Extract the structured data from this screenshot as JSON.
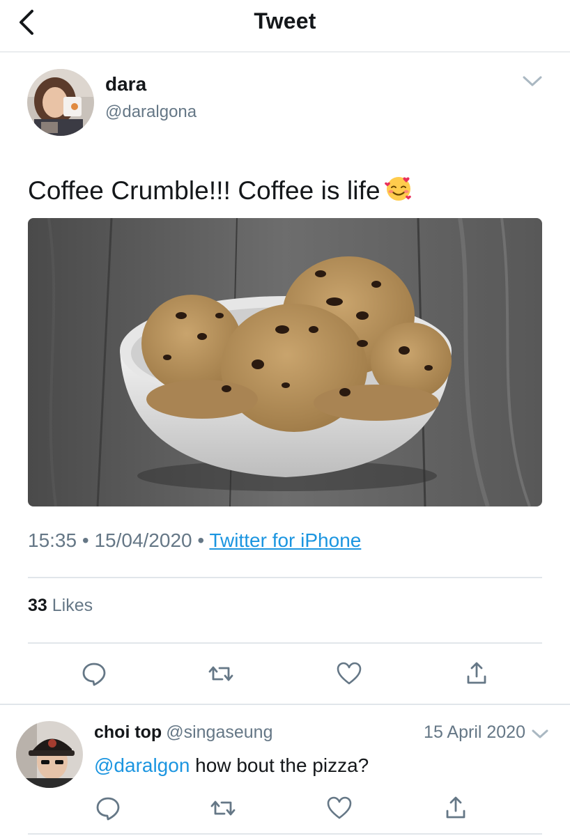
{
  "header": {
    "title": "Tweet",
    "back_icon": "chevron-left-icon"
  },
  "tweet": {
    "author_name": "dara",
    "author_handle": "@daralgona",
    "text": "Coffee Crumble!!! Coffee is life",
    "emoji": "smiling-face-with-hearts-icon",
    "media": "bowl of coffee crumble ice cream",
    "time": "15:35",
    "date": "15/04/2020",
    "separator": "•",
    "source": "Twitter for iPhone",
    "likes_count": "33",
    "likes_label": "Likes"
  },
  "reply": {
    "author_name": "choi top",
    "author_handle": "@singaseung",
    "date": "15 April 2020",
    "mention": "@daralgon",
    "text": " how bout the pizza?"
  },
  "actions": [
    "reply-icon",
    "retweet-icon",
    "like-icon",
    "share-icon"
  ],
  "colors": {
    "link": "#1b95e0",
    "secondary_text": "#657786",
    "divider": "#e1e6ea",
    "text": "#14171a"
  }
}
